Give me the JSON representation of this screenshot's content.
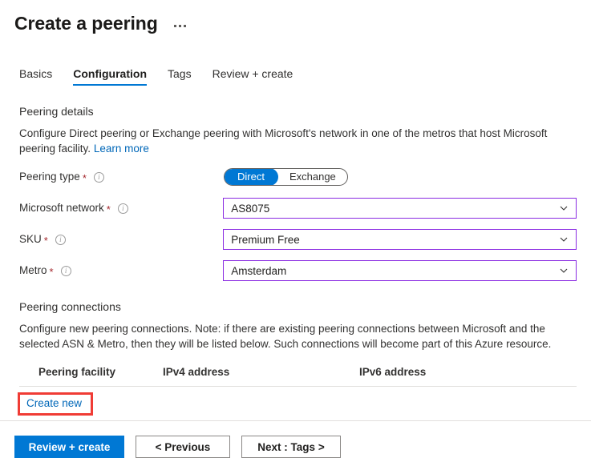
{
  "header": {
    "title": "Create a peering",
    "more_menu": "more-options"
  },
  "tabs": [
    {
      "label": "Basics",
      "active": false
    },
    {
      "label": "Configuration",
      "active": true
    },
    {
      "label": "Tags",
      "active": false
    },
    {
      "label": "Review + create",
      "active": false
    }
  ],
  "peering_details": {
    "title": "Peering details",
    "description": "Configure Direct peering or Exchange peering with Microsoft's network in one of the metros that host Microsoft peering facility.",
    "learn_more": "Learn more"
  },
  "fields": {
    "peering_type": {
      "label": "Peering type",
      "required": "*",
      "options": [
        "Direct",
        "Exchange"
      ],
      "selected": "Direct"
    },
    "microsoft_network": {
      "label": "Microsoft network",
      "required": "*",
      "value": "AS8075"
    },
    "sku": {
      "label": "SKU",
      "required": "*",
      "value": "Premium Free"
    },
    "metro": {
      "label": "Metro",
      "required": "*",
      "value": "Amsterdam"
    }
  },
  "peering_connections": {
    "title": "Peering connections",
    "description": "Configure new peering connections. Note: if there are existing peering connections between Microsoft and the selected ASN & Metro, then they will be listed below. Such connections will become part of this Azure resource.",
    "columns": [
      "Peering facility",
      "IPv4 address",
      "IPv6 address"
    ],
    "rows": [],
    "create_new": "Create new"
  },
  "footer": {
    "review_create": "Review + create",
    "previous": "< Previous",
    "next": "Next : Tags >"
  },
  "colors": {
    "accent": "#0078d4",
    "link": "#0067b8",
    "required": "#a4262c",
    "field_border": "#8a2be2",
    "annotation": "#f03c35"
  }
}
